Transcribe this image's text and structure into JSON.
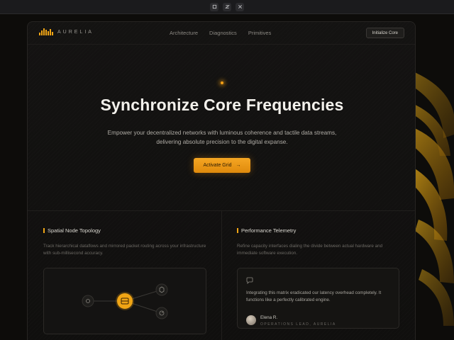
{
  "window": {
    "controls": [
      "restore-icon",
      "maximize-icon",
      "close-icon"
    ]
  },
  "nav": {
    "brand": "AURELIA",
    "links": [
      "Architecture",
      "Diagnostics",
      "Primitives"
    ],
    "cta_label": "Initialize Core"
  },
  "hero": {
    "title": "Synchronize Core Frequencies",
    "subtitle_line1": "Empower your decentralized networks with luminous coherence and tactile data streams,",
    "subtitle_line2": "delivering absolute precision to the digital expanse.",
    "cta_label": "Activate Grid",
    "cta_arrow": "→"
  },
  "panels": {
    "left": {
      "title": "Spatial Node Topology",
      "text": "Track hierarchical dataflows and mirrored packet routing across your infrastructure with sub-millisecond accuracy."
    },
    "right": {
      "title": "Performance Telemetry",
      "text": "Refine capacity interfaces dialing the divide between actual hardware and immediate software execution.",
      "quote": "Integrating this matrix eradicated our latency overhead completely. It functions like a perfectly calibrated engine.",
      "author_name": "Elena R.",
      "author_role": "OPERATIONS LEAD, AURELIA"
    }
  },
  "colors": {
    "accent": "#f0a515",
    "background": "#0d0c0a"
  }
}
